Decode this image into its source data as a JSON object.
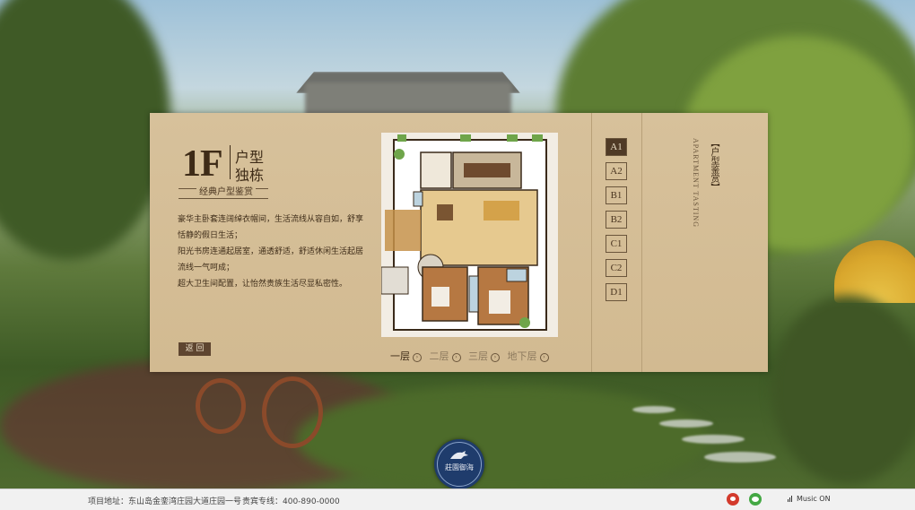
{
  "panel": {
    "floor_code": "1F",
    "heading_line1": "户型",
    "heading_line2": "独栋",
    "subtitle": "经典户型鉴赏",
    "description": [
      "豪华主卧套连阔绰衣帽间，生活流线从容自如，舒享",
      "恬静的假日生活；",
      "阳光书房连通起居室，通透舒适，舒适休闲生活起居",
      "流线一气呵成；",
      "超大卫生间配置，让怡然贵族生活尽显私密性。"
    ],
    "back_label": "返 回",
    "floors": [
      {
        "label": "一层",
        "active": true
      },
      {
        "label": "二层",
        "active": false
      },
      {
        "label": "三层",
        "active": false
      },
      {
        "label": "地下层",
        "active": false
      }
    ],
    "tabs": [
      {
        "label": "A1",
        "active": true
      },
      {
        "label": "A2",
        "active": false
      },
      {
        "label": "B1",
        "active": false
      },
      {
        "label": "B2",
        "active": false
      },
      {
        "label": "C1",
        "active": false
      },
      {
        "label": "C2",
        "active": false
      },
      {
        "label": "D1",
        "active": false
      }
    ],
    "vertical_title": "【户型鉴赏】",
    "vertical_en": "APARTMENT TASTING"
  },
  "logo": {
    "text": "莊園御海"
  },
  "footer": {
    "address": "项目地址：东山岛金銮湾庄园大道庄园一号",
    "phone": "贵宾专线：400-890-0000",
    "music": "Music ON"
  },
  "colors": {
    "panel": "#d4bd95",
    "accent_dark": "#4f3a26",
    "logo_blue": "#1f3c6c"
  }
}
